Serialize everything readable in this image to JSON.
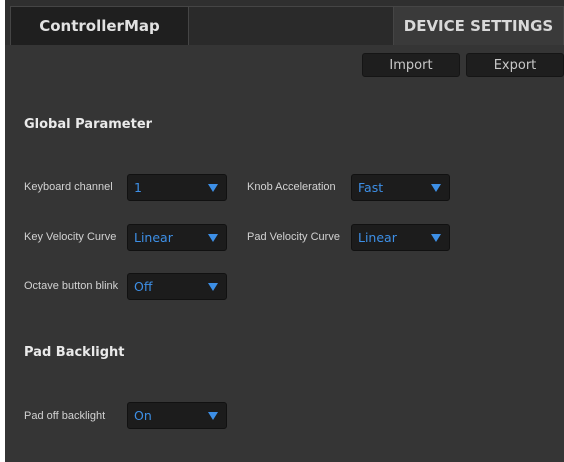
{
  "tabs": {
    "controller_map": "ControllerMap",
    "device_settings": "DEVICE SETTINGS"
  },
  "toolbar": {
    "import_label": "Import",
    "export_label": "Export"
  },
  "global_parameter": {
    "title": "Global Parameter",
    "keyboard_channel": {
      "label": "Keyboard channel",
      "value": "1"
    },
    "knob_acceleration": {
      "label": "Knob Acceleration",
      "value": "Fast"
    },
    "key_velocity_curve": {
      "label": "Key Velocity Curve",
      "value": "Linear"
    },
    "pad_velocity_curve": {
      "label": "Pad Velocity Curve",
      "value": "Linear"
    },
    "octave_button_blink": {
      "label": "Octave button blink",
      "value": "Off"
    }
  },
  "pad_backlight": {
    "title": "Pad Backlight",
    "pad_off_backlight": {
      "label": "Pad off backlight",
      "value": "On"
    }
  },
  "colors": {
    "background": "#353535",
    "select_text": "#3d8fe6",
    "select_bg": "#1c1c1c"
  }
}
